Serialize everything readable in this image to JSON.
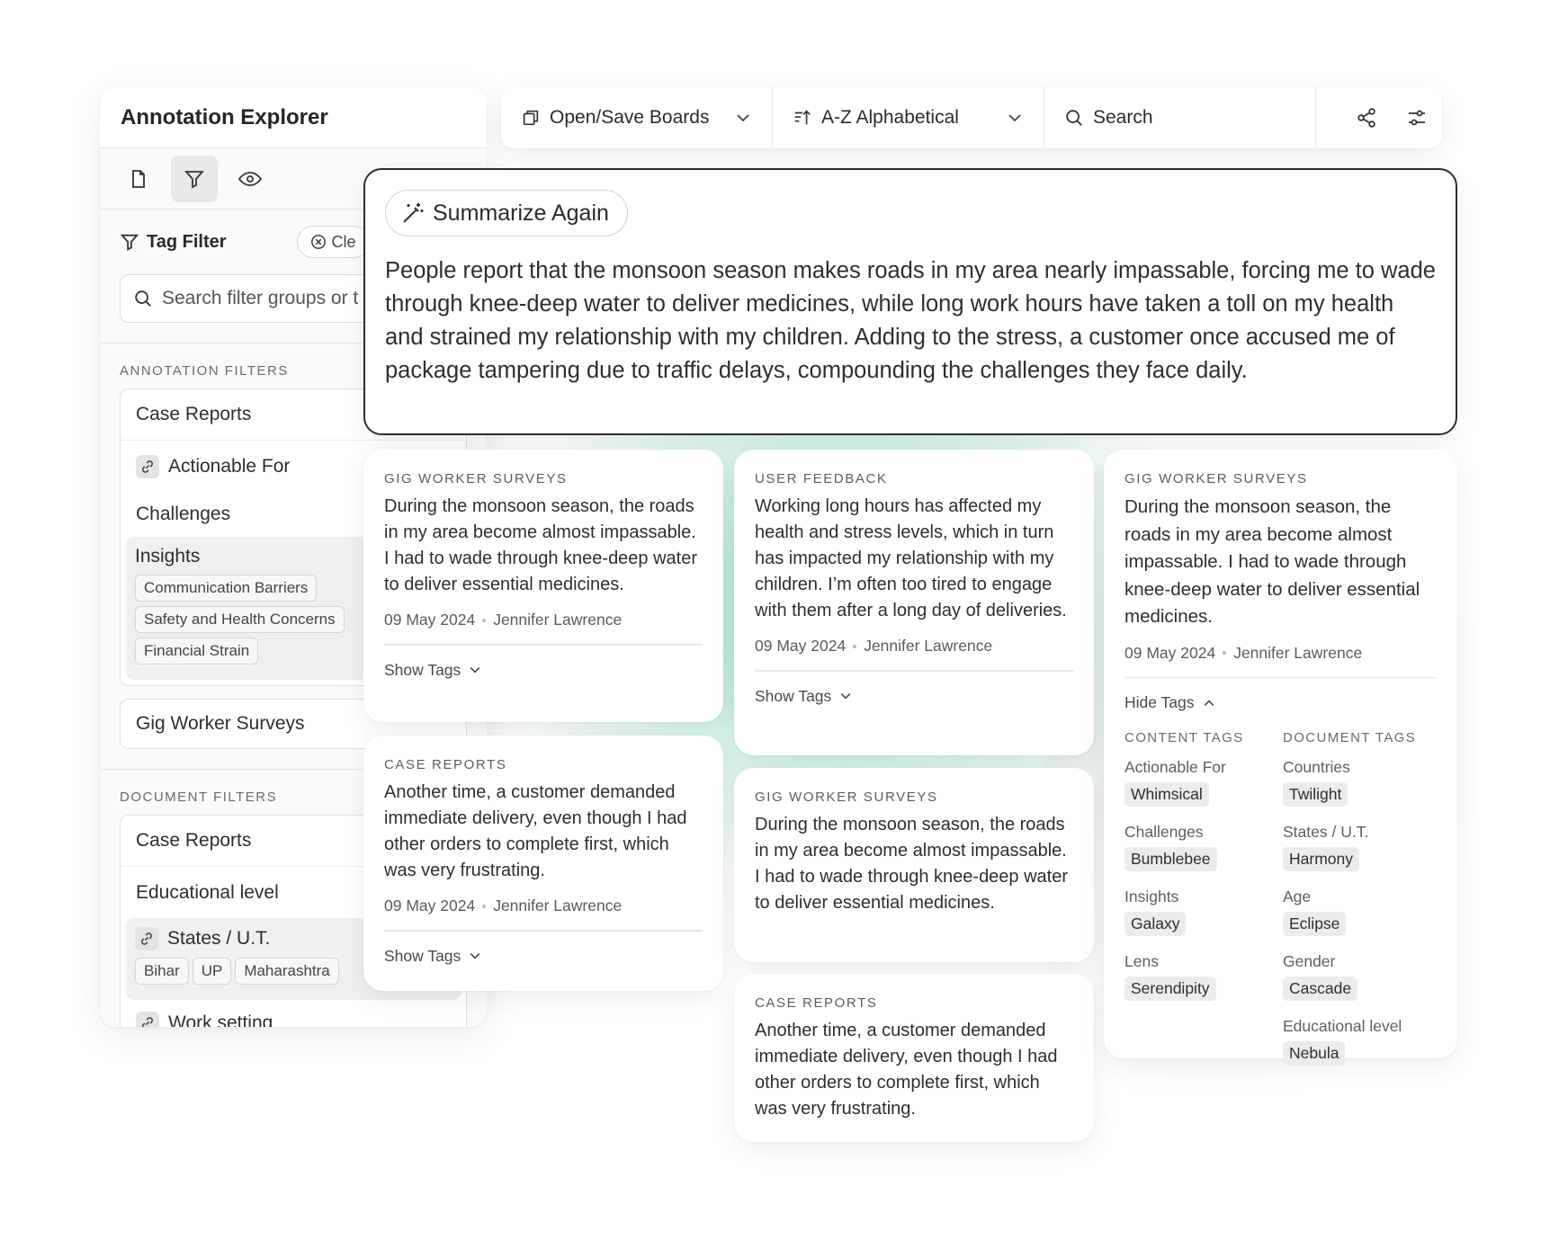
{
  "sidebar": {
    "title": "Annotation Explorer",
    "tag_filter_label": "Tag Filter",
    "clear_label": "Cle",
    "search_placeholder": "Search filter groups or t",
    "annotation_filters_heading": "ANNOTATION FILTERS",
    "annotation_filters": {
      "case_reports": "Case Reports",
      "actionable_for": "Actionable For",
      "challenges": "Challenges",
      "insights": "Insights",
      "insight_chips": [
        "Communication Barriers",
        "Safety and Health Concerns",
        "Financial Strain"
      ],
      "gig_worker_surveys": "Gig Worker Surveys"
    },
    "document_filters_heading": "DOCUMENT FILTERS",
    "document_filters": {
      "case_reports": "Case Reports",
      "educational_level": "Educational level",
      "states_ut": "States / U.T.",
      "state_chips": [
        "Bihar",
        "UP",
        "Maharashtra"
      ],
      "work_setting": "Work setting"
    }
  },
  "toolbar": {
    "boards_label": "Open/Save Boards",
    "sort_label": "A-Z Alphabetical",
    "search_label": "Search"
  },
  "summary": {
    "button_label": "Summarize Again",
    "text": "People report that the monsoon season makes roads in my area nearly impassable, forcing me to wade through knee-deep water to deliver medicines, while long work hours have taken a toll on my health and strained my relationship with my children. Adding to the stress, a customer once accused me of package tampering due to traffic delays, compounding the challenges they face daily."
  },
  "cards": {
    "c1": {
      "source": "GIG WORKER SURVEYS",
      "body": "During the monsoon season, the roads in my area become almost impassable. I had to wade through knee-deep water to deliver essential medicines.",
      "date": "09 May 2024",
      "author": "Jennifer Lawrence",
      "toggle": "Show Tags"
    },
    "c2": {
      "source": "CASE REPORTS",
      "body": "Another time, a customer demanded immediate delivery, even though I had other orders to complete first, which was very frustrating.",
      "date": "09 May 2024",
      "author": "Jennifer Lawrence",
      "toggle": "Show Tags"
    },
    "c3": {
      "source": "USER FEEDBACK",
      "body": "Working long hours has affected my health and stress levels, which in turn has impacted my relationship with my children. I’m often too tired to engage with them after a long day of deliveries.",
      "date": "09 May 2024",
      "author": "Jennifer Lawrence",
      "toggle": "Show Tags"
    },
    "c4": {
      "source": "GIG WORKER SURVEYS",
      "body": "During the monsoon season, the roads in my area become almost impassable. I had to wade through knee-deep water to deliver essential medicines."
    },
    "c5": {
      "source": "CASE REPORTS",
      "body": "Another time, a customer demanded immediate delivery, even though I had other orders to complete first, which was very frustrating."
    },
    "c6": {
      "source": "GIG WORKER SURVEYS",
      "body": "During the monsoon season, the roads in my area become almost impassable. I had to wade through knee-deep water to deliver essential medicines.",
      "date": "09 May 2024",
      "author": "Jennifer Lawrence",
      "toggle": "Hide Tags",
      "content_tags_heading": "CONTENT TAGS",
      "document_tags_heading": "DOCUMENT TAGS",
      "content_tags": [
        {
          "name": "Actionable For",
          "value": "Whimsical"
        },
        {
          "name": "Challenges",
          "value": "Bumblebee"
        },
        {
          "name": "Insights",
          "value": "Galaxy"
        },
        {
          "name": "Lens",
          "value": "Serendipity"
        }
      ],
      "document_tags": [
        {
          "name": "Countries",
          "value": "Twilight"
        },
        {
          "name": "States / U.T.",
          "value": "Harmony"
        },
        {
          "name": "Age",
          "value": "Eclipse"
        },
        {
          "name": "Gender",
          "value": "Cascade"
        },
        {
          "name": "Educational level",
          "value": "Nebula"
        }
      ]
    }
  },
  "colors": {
    "accent_glow": "#7fdcb7",
    "summary_border": "#2e2e2e",
    "chip_bg": "#ececec"
  }
}
